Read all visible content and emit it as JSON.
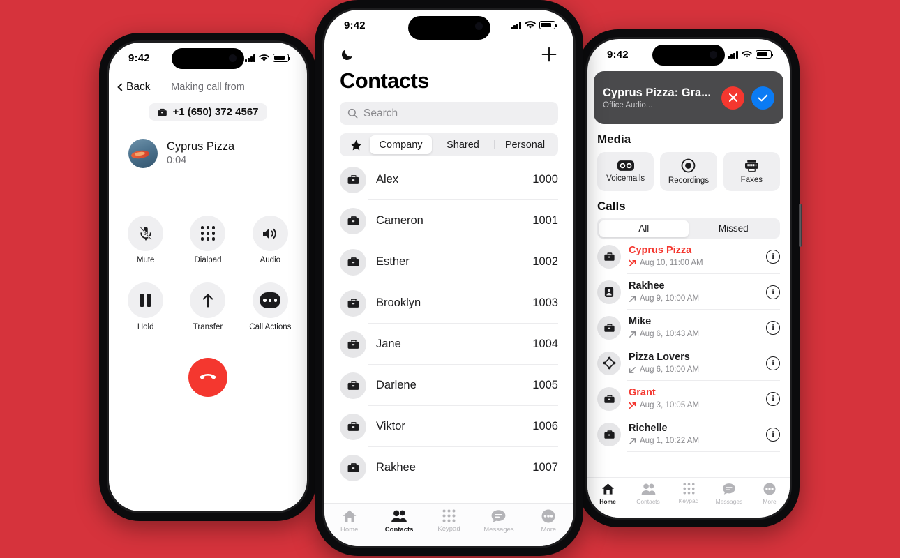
{
  "background_color": "#d6333c",
  "accent_colors": {
    "red": "#f4372f",
    "blue": "#0b7bf4",
    "dark": "#1c1c1e",
    "banner_bg": "#4a4a4c"
  },
  "phone_left": {
    "status": {
      "time": "9:42",
      "signal_icon": "cellular-bars-icon",
      "wifi_icon": "wifi-icon",
      "battery_icon": "battery-icon"
    },
    "nav": {
      "back_label": "Back",
      "title": "Making call from"
    },
    "from_pill": {
      "icon": "briefcase-icon",
      "number": "+1 (650) 372 4567"
    },
    "callee": {
      "name": "Cyprus Pizza",
      "duration": "0:04",
      "avatar": "contact-photo"
    },
    "controls": [
      {
        "label": "Mute",
        "icon": "microphone-muted-icon"
      },
      {
        "label": "Dialpad",
        "icon": "dialpad-icon"
      },
      {
        "label": "Audio",
        "icon": "speaker-icon"
      },
      {
        "label": "Hold",
        "icon": "pause-icon"
      },
      {
        "label": "Transfer",
        "icon": "arrow-up-icon"
      },
      {
        "label": "Call Actions",
        "icon": "ellipsis-icon"
      }
    ],
    "end_call": {
      "icon": "end-call-icon"
    }
  },
  "phone_center": {
    "status": {
      "time": "9:42"
    },
    "top_bar": {
      "left_icon": "moon-icon",
      "right_icon": "plus-icon"
    },
    "title": "Contacts",
    "search": {
      "placeholder": "Search",
      "icon": "search-icon"
    },
    "segments": {
      "star_icon": "star-icon",
      "items": [
        "Company",
        "Shared",
        "Personal"
      ],
      "active": "Company"
    },
    "contacts": [
      {
        "name": "Alex",
        "extension": "1000",
        "icon": "briefcase-icon"
      },
      {
        "name": "Cameron",
        "extension": "1001",
        "icon": "briefcase-icon"
      },
      {
        "name": "Esther",
        "extension": "1002",
        "icon": "briefcase-icon"
      },
      {
        "name": "Brooklyn",
        "extension": "1003",
        "icon": "briefcase-icon"
      },
      {
        "name": "Jane",
        "extension": "1004",
        "icon": "briefcase-icon"
      },
      {
        "name": "Darlene",
        "extension": "1005",
        "icon": "briefcase-icon"
      },
      {
        "name": "Viktor",
        "extension": "1006",
        "icon": "briefcase-icon"
      },
      {
        "name": "Rakhee",
        "extension": "1007",
        "icon": "briefcase-icon"
      }
    ],
    "tabs": [
      {
        "label": "Home",
        "icon": "home-icon",
        "active": false
      },
      {
        "label": "Contacts",
        "icon": "contacts-icon",
        "active": true
      },
      {
        "label": "Keypad",
        "icon": "keypad-icon",
        "active": false
      },
      {
        "label": "Messages",
        "icon": "messages-icon",
        "active": false
      },
      {
        "label": "More",
        "icon": "more-icon",
        "active": false
      }
    ]
  },
  "phone_right": {
    "status": {
      "time": "9:42"
    },
    "incoming_banner": {
      "title": "Cyprus Pizza: Gra...",
      "subtitle": "Office Audio...",
      "decline_icon": "close-icon",
      "accept_icon": "check-icon"
    },
    "media": {
      "heading": "Media",
      "cards": [
        {
          "label": "Voicemails",
          "icon": "voicemail-icon"
        },
        {
          "label": "Recordings",
          "icon": "record-icon"
        },
        {
          "label": "Faxes",
          "icon": "fax-icon"
        }
      ]
    },
    "calls": {
      "heading": "Calls",
      "filters": [
        "All",
        "Missed"
      ],
      "active_filter": "All",
      "items": [
        {
          "name": "Cyprus Pizza",
          "time": "Aug 10, 11:00 AM",
          "direction": "missed",
          "icon": "briefcase-icon",
          "info_icon": "info-icon"
        },
        {
          "name": "Rakhee",
          "time": "Aug 9, 10:00 AM",
          "direction": "outgoing",
          "icon": "contact-card-icon",
          "info_icon": "info-icon"
        },
        {
          "name": "Mike",
          "time": "Aug 6, 10:43 AM",
          "direction": "outgoing",
          "icon": "briefcase-icon",
          "info_icon": "info-icon"
        },
        {
          "name": "Pizza Lovers",
          "time": "Aug 6, 10:00 AM",
          "direction": "incoming",
          "icon": "group-icon",
          "info_icon": "info-icon"
        },
        {
          "name": "Grant",
          "time": "Aug 3, 10:05 AM",
          "direction": "missed",
          "icon": "briefcase-icon",
          "info_icon": "info-icon"
        },
        {
          "name": "Richelle",
          "time": "Aug 1, 10:22 AM",
          "direction": "outgoing",
          "icon": "briefcase-icon",
          "info_icon": "info-icon"
        }
      ]
    },
    "tabs": [
      {
        "label": "Home",
        "icon": "home-icon",
        "active": true
      },
      {
        "label": "Contacts",
        "icon": "contacts-icon",
        "active": false
      },
      {
        "label": "Keypad",
        "icon": "keypad-icon",
        "active": false
      },
      {
        "label": "Messages",
        "icon": "messages-icon",
        "active": false
      },
      {
        "label": "More",
        "icon": "more-icon",
        "active": false
      }
    ]
  }
}
